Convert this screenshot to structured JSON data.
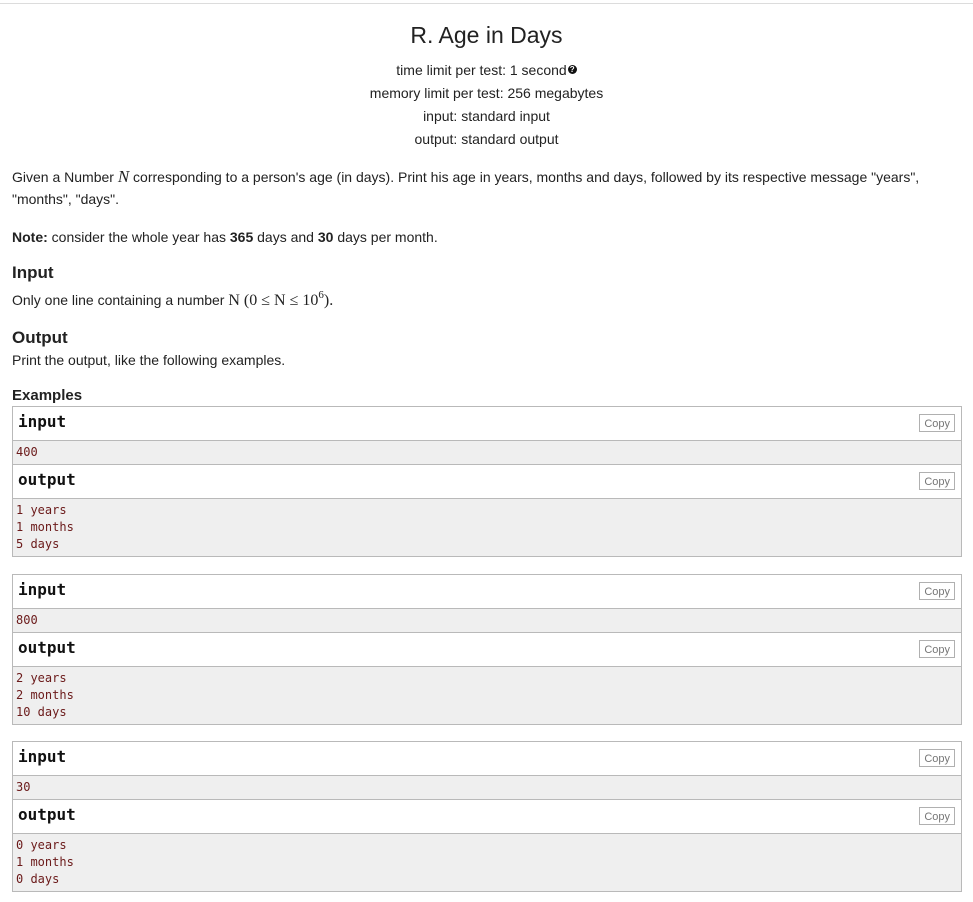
{
  "problem": {
    "title": "R. Age in Days",
    "time_limit": "time limit per test: 1 second",
    "memory_limit": "memory limit per test: 256 megabytes",
    "input_file": "input: standard input",
    "output_file": "output: standard output"
  },
  "statement": {
    "text_before": "Given a Number ",
    "var": "N",
    "text_after": " corresponding to a person's age (in days). Print his age in years, months and days, followed by its respective message \"years\", \"months\", \"days\".",
    "note_label": "Note:",
    "note_a": " consider the whole year has ",
    "note_days": "365",
    "note_b": " days and ",
    "note_month": "30",
    "note_c": " days per month."
  },
  "input_section": {
    "title": "Input",
    "text": "Only one line containing a number ",
    "constraint": "N (0 ≤ N ≤ 10",
    "exp": "6",
    "close": ")."
  },
  "output_section": {
    "title": "Output",
    "text": "Print the output, like the following examples."
  },
  "examples_title": "Examples",
  "copy_label": "Copy",
  "input_label": "input",
  "output_label": "output",
  "examples": [
    {
      "input": "400",
      "output": "1 years\n1 months\n5 days"
    },
    {
      "input": "800",
      "output": "2 years\n2 months\n10 days"
    },
    {
      "input": "30",
      "output": "0 years\n1 months\n0 days"
    }
  ]
}
